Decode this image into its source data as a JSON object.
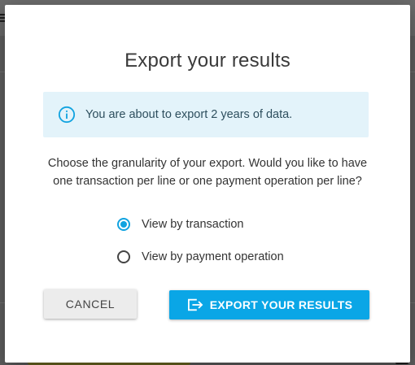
{
  "dialog": {
    "title": "Export your results",
    "info": {
      "icon": "info-circle-icon",
      "text": "You are about to export 2 years of data."
    },
    "description_line1": "Choose the granularity of your export. Would you like to have",
    "description_line2": "one transaction per line or one payment operation per line?",
    "options": [
      {
        "label": "View by transaction",
        "selected": true
      },
      {
        "label": "View by payment operation",
        "selected": false
      }
    ],
    "cancel_label": "CANCEL",
    "export_label": "EXPORT YOUR RESULTS",
    "export_icon": "export-arrow-icon"
  },
  "colors": {
    "accent": "#0aa6e6",
    "info_background": "#e3f3fa",
    "overlay": "#5f5f5f"
  }
}
